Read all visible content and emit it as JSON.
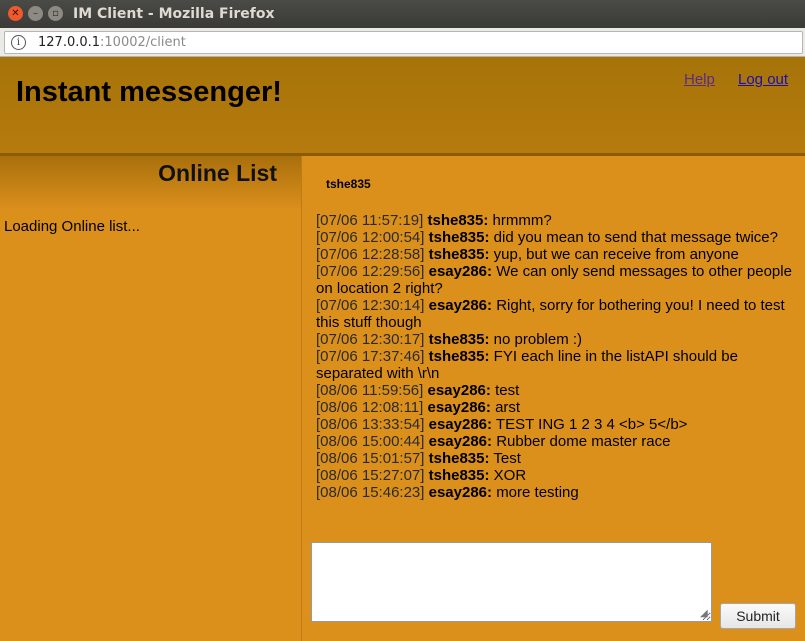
{
  "window": {
    "title": "IM Client - Mozilla Firefox"
  },
  "browser": {
    "url_host": "127.0.0.1",
    "url_rest": ":10002/client"
  },
  "header": {
    "title": "Instant messenger!",
    "help_label": "Help",
    "logout_label": "Log out"
  },
  "sidebar": {
    "title": "Online List",
    "status": "Loading Online list..."
  },
  "chat": {
    "active_user": "tshe835",
    "messages": [
      {
        "time": "[07/06 11:57:19]",
        "sender": "tshe835:",
        "text": "hrmmm?"
      },
      {
        "time": "[07/06 12:00:54]",
        "sender": "tshe835:",
        "text": "did you mean to send that message twice?"
      },
      {
        "time": "[07/06 12:28:58]",
        "sender": "tshe835:",
        "text": "yup, but we can receive from anyone"
      },
      {
        "time": "[07/06 12:29:56]",
        "sender": "esay286:",
        "text": "We can only send messages to other people on location 2 right?"
      },
      {
        "time": "[07/06 12:30:14]",
        "sender": "esay286:",
        "text": "Right, sorry for bothering you! I need to test this stuff though"
      },
      {
        "time": "[07/06 12:30:17]",
        "sender": "tshe835:",
        "text": "no problem :)"
      },
      {
        "time": "[07/06 17:37:46]",
        "sender": "tshe835:",
        "text": "FYI each line in the listAPI should be separated with \\r\\n"
      },
      {
        "time": "[08/06 11:59:56]",
        "sender": "esay286:",
        "text": "test"
      },
      {
        "time": "[08/06 12:08:11]",
        "sender": "esay286:",
        "text": "arst"
      },
      {
        "time": "[08/06 13:33:54]",
        "sender": "esay286:",
        "text": "TEST ING 1 2 3 4 <b> 5</b>"
      },
      {
        "time": "[08/06 15:00:44]",
        "sender": "esay286:",
        "text": "Rubber dome master race"
      },
      {
        "time": "[08/06 15:01:57]",
        "sender": "tshe835:",
        "text": "Test"
      },
      {
        "time": "[08/06 15:27:07]",
        "sender": "tshe835:",
        "text": "XOR"
      },
      {
        "time": "[08/06 15:46:23]",
        "sender": "esay286:",
        "text": "more testing"
      }
    ],
    "input_value": "",
    "submit_label": "Submit"
  },
  "icons": {
    "close": "close-icon",
    "minimize": "minimize-icon",
    "maximize": "maximize-icon",
    "info": "info-icon"
  },
  "colors": {
    "background": "#DC901C",
    "header": "#B67A0E"
  }
}
